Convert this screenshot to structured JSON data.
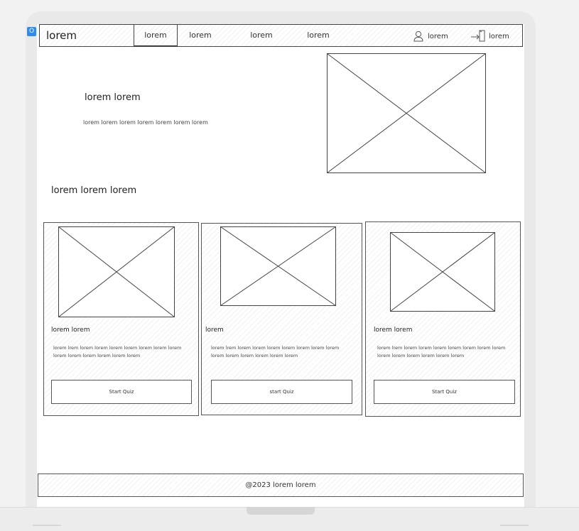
{
  "badge": "O",
  "navbar": {
    "brand": "lorem",
    "items": [
      {
        "label": "lorem",
        "active": true
      },
      {
        "label": "lorem"
      },
      {
        "label": "lorem"
      },
      {
        "label": "lorem"
      }
    ],
    "user": {
      "icon": "user-icon",
      "label": "lorem"
    },
    "logout": {
      "icon": "login-icon",
      "label": "lorem"
    }
  },
  "hero": {
    "title": "lorem lorem",
    "text": "lorem lorem lorem lorem lorem lorem lorem",
    "image": "image-placeholder"
  },
  "section": {
    "title": "lorem lorem lorem"
  },
  "cards": [
    {
      "title": "lorem lorem",
      "desc": "lorem lrem lorem lorem lorem lorem lorem lorem lorem lorem lorem lorem lorem lorem lorem",
      "button": "Start Quiz"
    },
    {
      "title": "lorem",
      "desc": "lorem lrem lorem lorem lorem lorem lorem lorem lorem lorem lorem lorem lorem lorem lorem",
      "button": "start Quiz"
    },
    {
      "title": "lorem lorem",
      "desc": "lorem lrem lorem lorem lorem lorem lorem lorem lorem lorem lorem lorem lorem lorem lorem",
      "button": "Start Quiz"
    }
  ],
  "footer": {
    "text": "@2023 lorem lorem"
  }
}
